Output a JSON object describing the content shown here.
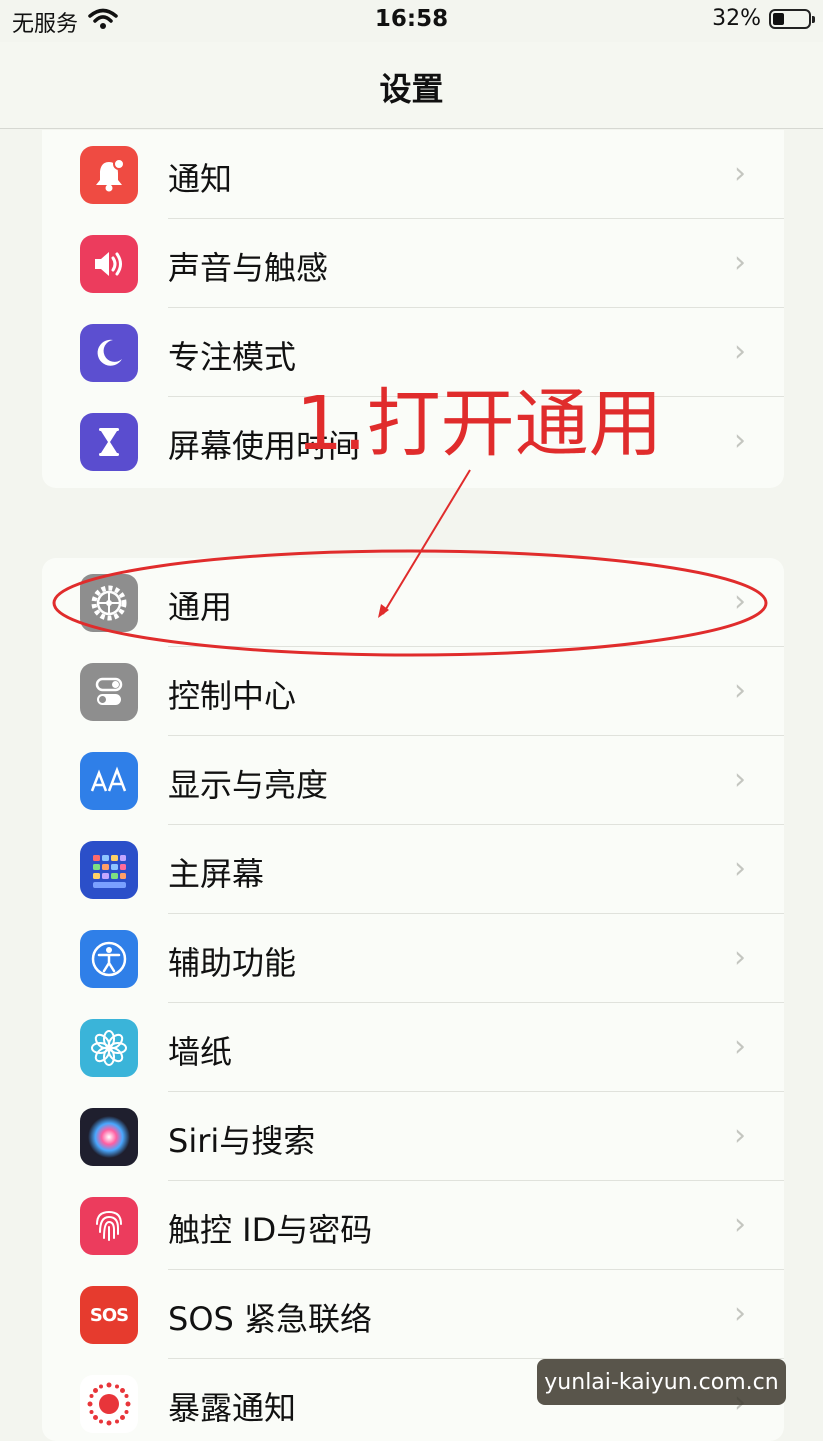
{
  "status_bar": {
    "carrier": "无服务",
    "time": "16:58",
    "battery_percent": "32%",
    "battery_level": 0.32,
    "wifi_icon": "wifi-icon"
  },
  "nav": {
    "title": "设置"
  },
  "group1": [
    {
      "label": "通知",
      "icon": "bell-icon",
      "color": "#ef4b42"
    },
    {
      "label": "声音与触感",
      "icon": "speaker-icon",
      "color": "#ec3c5d"
    },
    {
      "label": "专注模式",
      "icon": "moon-icon",
      "color": "#5c4fd0"
    },
    {
      "label": "屏幕使用时间",
      "icon": "hourglass-icon",
      "color": "#5a4dcf"
    }
  ],
  "group2": [
    {
      "label": "通用",
      "icon": "gear-icon",
      "color": "#8e8e8e"
    },
    {
      "label": "控制中心",
      "icon": "toggles-icon",
      "color": "#8e8e8e"
    },
    {
      "label": "显示与亮度",
      "icon": "text-size-icon",
      "color": "#2f7fe8"
    },
    {
      "label": "主屏幕",
      "icon": "home-grid-icon",
      "color": "#2b4fc9"
    },
    {
      "label": "辅助功能",
      "icon": "accessibility-icon",
      "color": "#2f7fe8"
    },
    {
      "label": "墙纸",
      "icon": "flower-icon",
      "color": "#3ab4d9"
    },
    {
      "label": "Siri与搜索",
      "icon": "siri-icon",
      "color": "#1f1f2e"
    },
    {
      "label": "触控 ID与密码",
      "icon": "fingerprint-icon",
      "color": "#ec3c5d"
    },
    {
      "label": "SOS 紧急联络",
      "icon": "sos-icon",
      "color": "#e63b2e"
    },
    {
      "label": "暴露通知",
      "icon": "exposure-icon",
      "color": "#ffffff"
    }
  ],
  "annotation": {
    "text": "1.打开通用",
    "color": "#e02c2c"
  },
  "watermark": {
    "text": "yunlai-kaiyun.com.cn"
  },
  "chevron": "›"
}
